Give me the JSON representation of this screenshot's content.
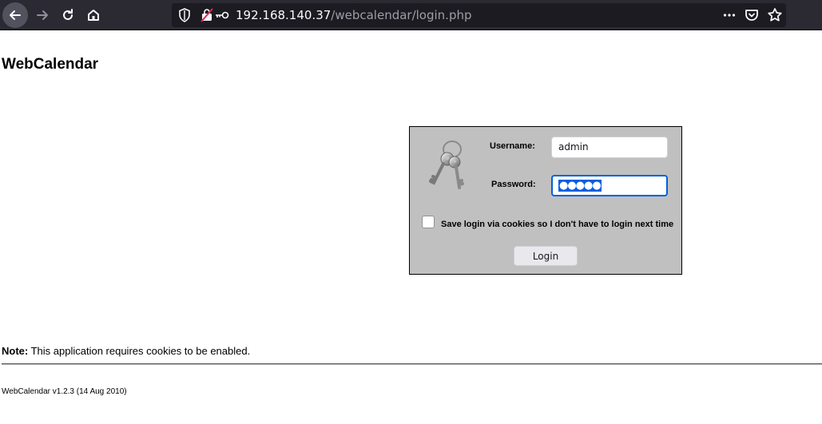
{
  "browser": {
    "url_host": "192.168.140.37",
    "url_path": "/webcalendar/login.php",
    "icons": [
      "back-arrow-icon",
      "forward-arrow-icon",
      "reload-icon",
      "home-icon",
      "shield-icon",
      "insecure-lock-icon",
      "key-icon",
      "more-icon",
      "pocket-icon",
      "bookmark-star-icon"
    ]
  },
  "page": {
    "title": "WebCalendar",
    "login": {
      "username_label": "Username:",
      "username_value": "admin",
      "password_label": "Password:",
      "password_masked": "●●●●●",
      "remember_label": "Save login via cookies so I don't have to login next time",
      "remember_checked": false,
      "submit_label": "Login"
    },
    "note_label": "Note:",
    "note_text": " This application requires cookies to be enabled.",
    "footer": "WebCalendar v1.2.3 (14 Aug 2010)"
  },
  "colors": {
    "toolbar_bg": "#2b2a33",
    "urlbar_bg": "#1c1b22",
    "login_box_bg": "#c0c0c0",
    "focus_accent": "#0060df"
  }
}
